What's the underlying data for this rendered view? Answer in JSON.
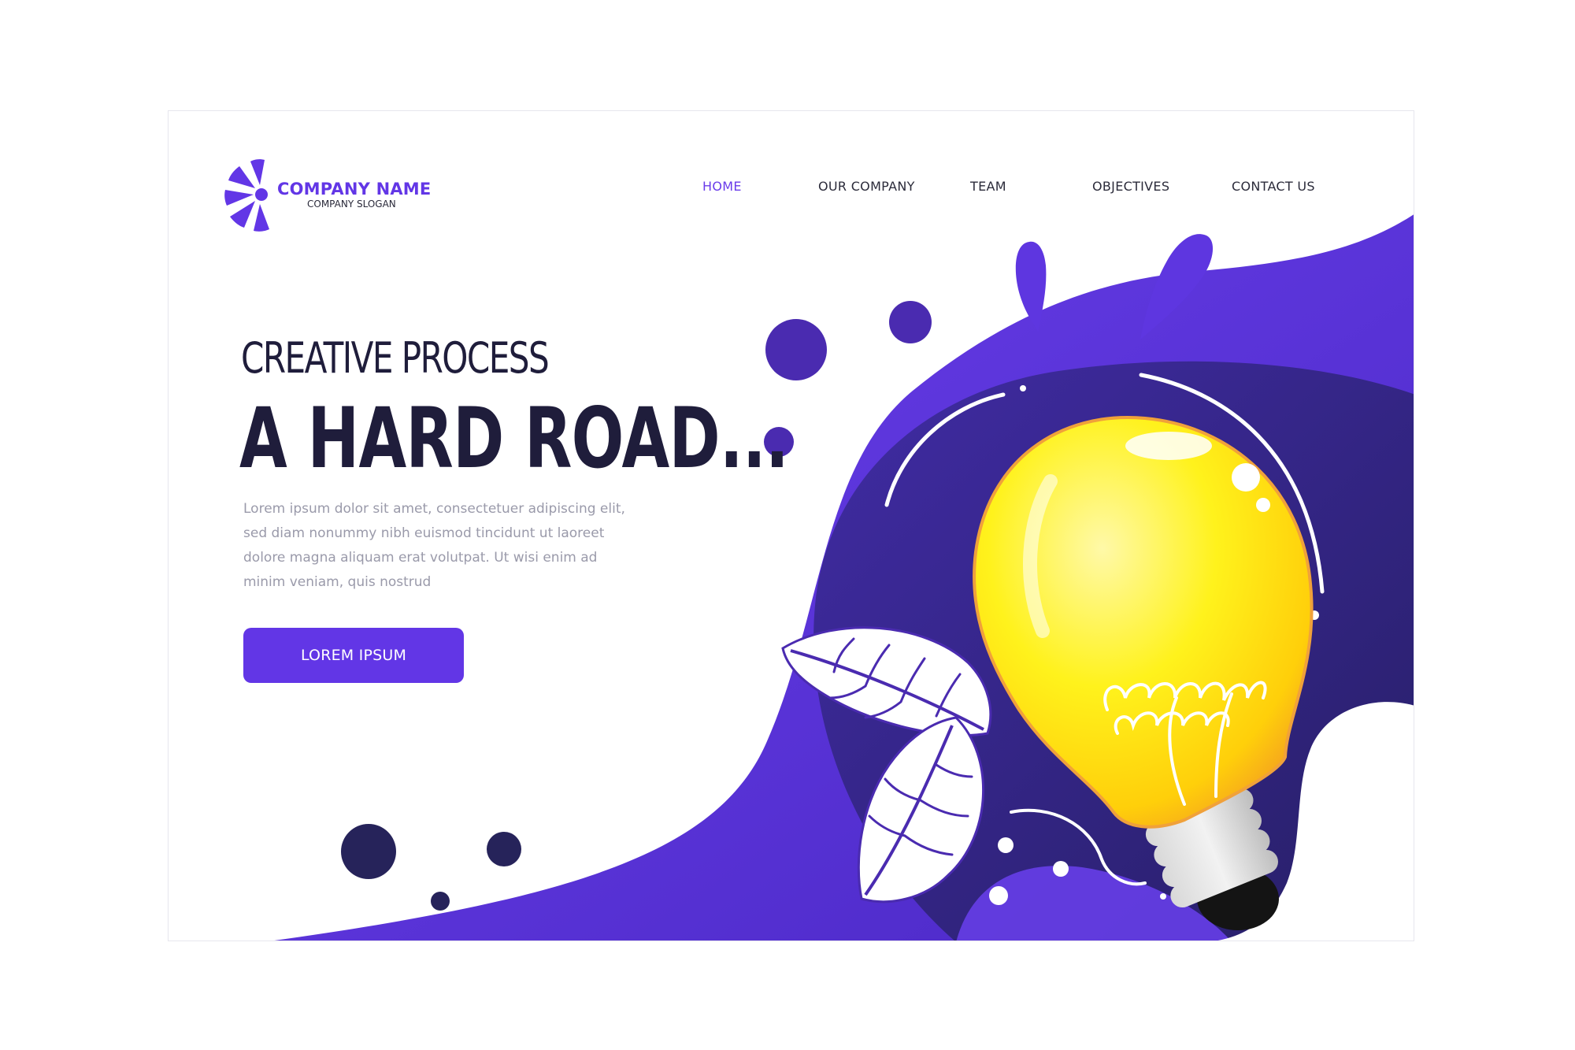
{
  "brand": {
    "name": "COMPANY NAME",
    "slogan": "COMPANY SLOGAN"
  },
  "nav": {
    "items": [
      {
        "label": "HOME",
        "active": true
      },
      {
        "label": "OUR COMPANY",
        "active": false
      },
      {
        "label": "TEAM",
        "active": false
      },
      {
        "label": "OBJECTIVES",
        "active": false
      },
      {
        "label": "CONTACT US",
        "active": false
      }
    ]
  },
  "hero": {
    "subtitle": "CREATIVE PROCESS",
    "title": "A HARD ROAD...",
    "body_lines": [
      "Lorem ipsum dolor sit amet, consectetuer adipiscing elit,",
      "sed diam nonummy nibh euismod tincidunt ut laoreet",
      "dolore magna aliquam erat volutpat. Ut wisi enim ad",
      "minim veniam, quis nostrud"
    ],
    "cta_label": "LOREM IPSUM"
  },
  "illustration": {
    "name": "lightbulb-with-leaves",
    "icons": [
      "lightbulb-icon",
      "leaf-icon"
    ]
  },
  "colors": {
    "accent": "#6236e6",
    "dark_purple": "#2a2466",
    "navy": "#26235a",
    "bulb_yellow": "#ffe81a",
    "title_text": "#1f1d3b",
    "body_text": "#9a9aaa"
  }
}
